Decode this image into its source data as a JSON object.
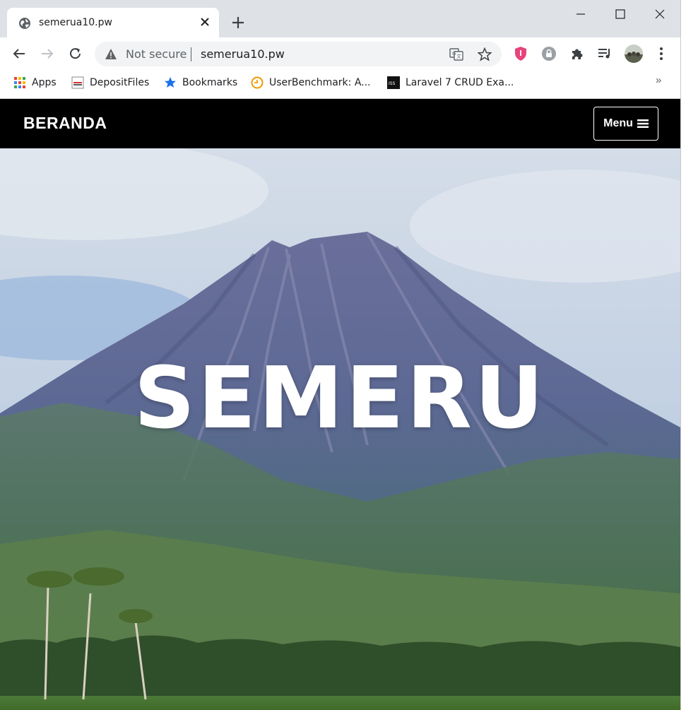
{
  "browser": {
    "tab": {
      "title": "semerua10.pw",
      "favicon": "globe-icon"
    },
    "address_bar": {
      "security_label": "Not secure",
      "url": "semerua10.pw"
    },
    "bookmarks": [
      {
        "label": "Apps",
        "icon": "apps-grid-icon"
      },
      {
        "label": "DepositFiles",
        "icon": "depositfiles-icon"
      },
      {
        "label": "Bookmarks",
        "icon": "star-icon"
      },
      {
        "label": "UserBenchmark: A...",
        "icon": "userbenchmark-icon"
      },
      {
        "label": "Laravel 7 CRUD Exa...",
        "icon": "laravel-site-icon"
      }
    ],
    "bookmarks_overflow": "»"
  },
  "site": {
    "brand": "BERANDA",
    "menu_label": "Menu",
    "hero_title": "SEMERU"
  },
  "colors": {
    "nav_background": "#000000",
    "tabstrip": "#dee1e6",
    "omnibox": "#f1f3f4"
  }
}
